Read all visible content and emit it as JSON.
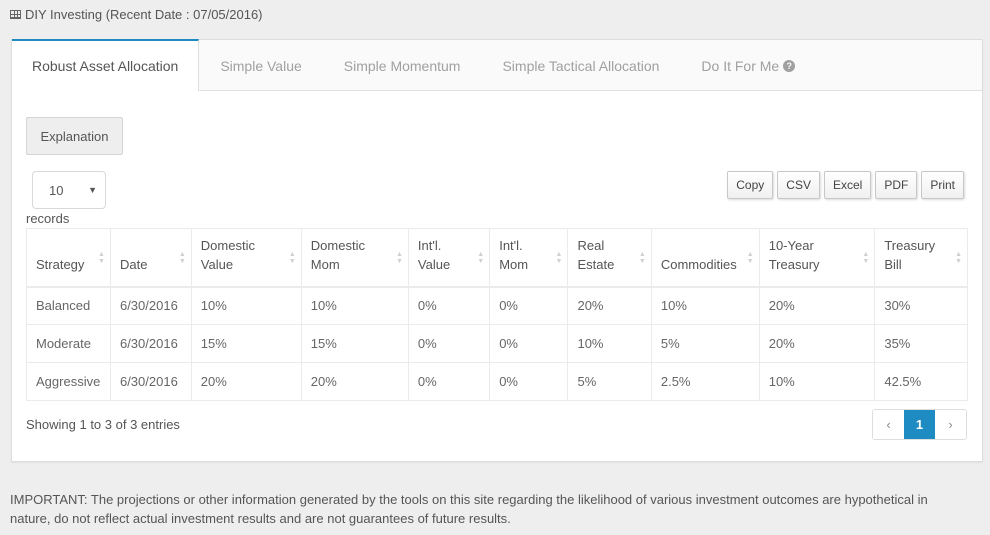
{
  "header": {
    "icon": "table-icon",
    "title": "DIY Investing (Recent Date : 07/05/2016)"
  },
  "tabs": [
    {
      "label": "Robust Asset Allocation",
      "active": true
    },
    {
      "label": "Simple Value",
      "active": false
    },
    {
      "label": "Simple Momentum",
      "active": false
    },
    {
      "label": "Simple Tactical Allocation",
      "active": false
    },
    {
      "label": "Do It For Me",
      "active": false,
      "icon": "question-circle-icon"
    }
  ],
  "toolbar": {
    "explanation_label": "Explanation",
    "page_length": "10",
    "records_label": "records",
    "export_buttons": [
      "Copy",
      "CSV",
      "Excel",
      "PDF",
      "Print"
    ]
  },
  "table": {
    "columns": [
      [
        "Strategy"
      ],
      [
        "Date"
      ],
      [
        "Domestic",
        "Value"
      ],
      [
        "Domestic",
        "Mom"
      ],
      [
        "Int'l.",
        "Value"
      ],
      [
        "Int'l.",
        "Mom"
      ],
      [
        "Real",
        "Estate"
      ],
      [
        "Commodities"
      ],
      [
        "10-Year",
        "Treasury"
      ],
      [
        "Treasury",
        "Bill"
      ]
    ],
    "rows": [
      [
        "Balanced",
        "6/30/2016",
        "10%",
        "10%",
        "0%",
        "0%",
        "20%",
        "10%",
        "20%",
        "30%"
      ],
      [
        "Moderate",
        "6/30/2016",
        "15%",
        "15%",
        "0%",
        "0%",
        "10%",
        "5%",
        "20%",
        "35%"
      ],
      [
        "Aggressive",
        "6/30/2016",
        "20%",
        "20%",
        "0%",
        "0%",
        "5%",
        "2.5%",
        "10%",
        "42.5%"
      ]
    ]
  },
  "footer": {
    "info": "Showing 1 to 3 of 3 entries",
    "pagination": {
      "prev": "‹",
      "current": "1",
      "next": "›"
    }
  },
  "disclaimer": "IMPORTANT: The projections or other information generated by the tools on this site regarding the likelihood of various investment outcomes are hypothetical in nature, do not reflect actual investment results and are not guarantees of future results.",
  "colors": {
    "accent": "#1e8bc3",
    "background": "#eeeeee"
  }
}
